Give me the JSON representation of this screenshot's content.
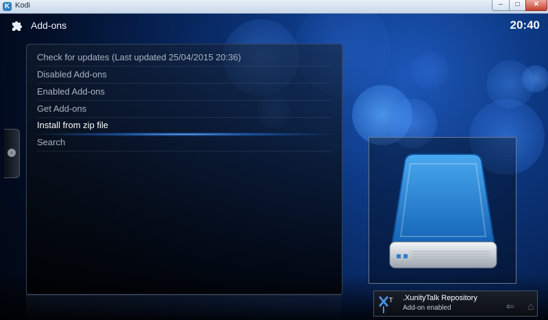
{
  "window": {
    "title": "Kodi",
    "app_icon_glyph": "K",
    "buttons": {
      "minimize": "–",
      "maximize": "□",
      "close": "✕"
    }
  },
  "header": {
    "title": "Add-ons",
    "icon": "puzzle-icon",
    "clock": "20:40"
  },
  "menu": {
    "items": [
      {
        "label": "Check for updates (Last updated 25/04/2015 20:36)"
      },
      {
        "label": "Disabled Add-ons"
      },
      {
        "label": "Enabled Add-ons"
      },
      {
        "label": "Get Add-ons"
      },
      {
        "label": "Install from zip file",
        "focused": true
      },
      {
        "label": "Search"
      }
    ]
  },
  "side_tab": {
    "glyph": "›"
  },
  "preview": {
    "icon": "hard-drive-icon"
  },
  "notification": {
    "icon": "xunitytalk-logo-icon",
    "title": ".XunityTalk Repository",
    "message": "Add-on enabled"
  },
  "corner_controls": {
    "back_glyph": "⇐",
    "home_glyph": "⌂"
  },
  "colors": {
    "background": "#0d3a86",
    "focus_glow": "#3f9cff",
    "text_dim": "#aab4c2",
    "text_focused": "#ffffff"
  }
}
